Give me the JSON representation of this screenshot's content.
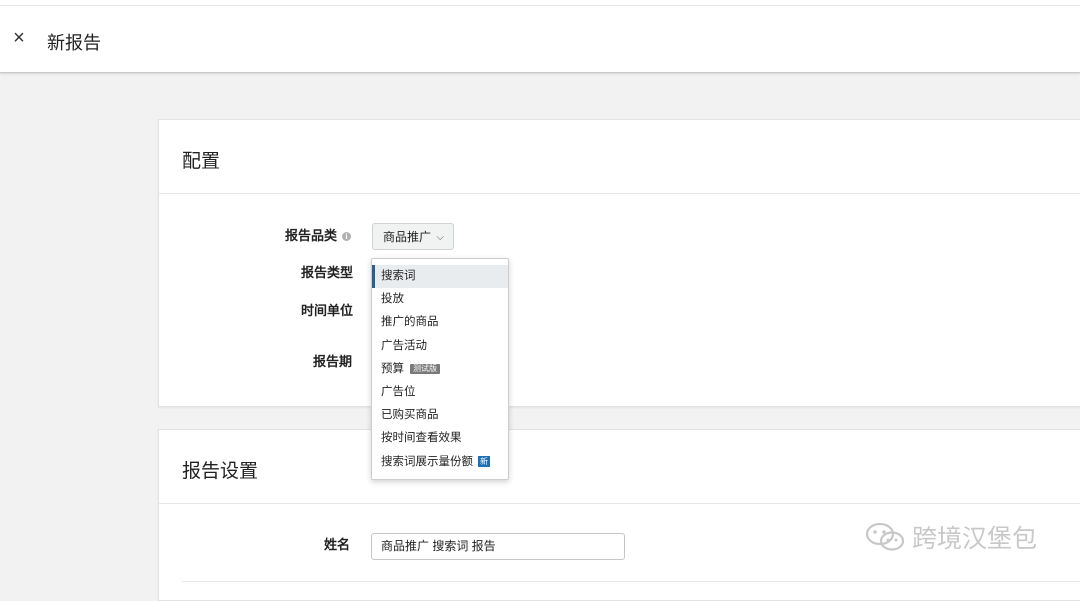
{
  "header": {
    "close_icon": "×",
    "title": "新报告"
  },
  "config": {
    "title": "配置",
    "category_label": "报告品类",
    "category_info_icon": "i",
    "category_value": "商品推广",
    "type_label": "报告类型",
    "time_unit_label": "时间单位",
    "period_label": "报告期"
  },
  "dropdown": {
    "items": [
      {
        "label": "搜索词",
        "selected": true
      },
      {
        "label": "投放"
      },
      {
        "label": "推广的商品"
      },
      {
        "label": "广告活动"
      },
      {
        "label": "预算",
        "badge": "测试版"
      },
      {
        "label": "广告位"
      },
      {
        "label": "已购买商品"
      },
      {
        "label": "按时间查看效果"
      },
      {
        "label": "搜索词展示量份额",
        "badge": "新"
      }
    ]
  },
  "report_settings": {
    "title": "报告设置",
    "name_label": "姓名",
    "name_value": "商品推广 搜索词 报告"
  },
  "watermark": {
    "text": "跨境汉堡包"
  },
  "colors": {
    "accent": "#2b5f8f",
    "new_badge": "#1f6fb5",
    "page_bg": "#f2f2f2"
  }
}
